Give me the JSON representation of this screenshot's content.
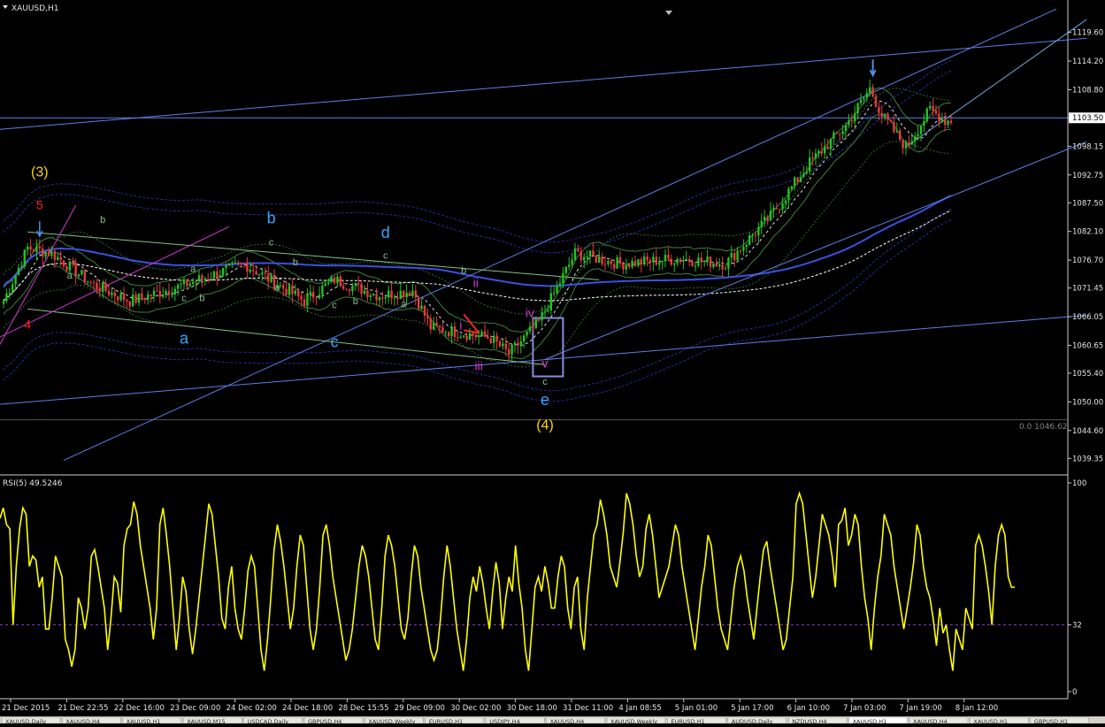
{
  "window": {
    "symbol_title": "XAUUSD,H1"
  },
  "rsi": {
    "title": "RSI(5) 49.5246",
    "ticks": [
      100,
      32,
      0
    ]
  },
  "price_axis": {
    "ticks": [
      "1119.60",
      "1114.20",
      "1108.80",
      "1103.50",
      "1098.15",
      "1092.75",
      "1087.50",
      "1082.10",
      "1076.70",
      "1071.45",
      "1066.05",
      "1060.65",
      "1055.40",
      "1050.00",
      "1044.60",
      "1039.35"
    ],
    "current_price": "1103.50",
    "fib_label": "0.0 1046.62"
  },
  "colors": {
    "background": "#000000",
    "candle_up": "#22c322",
    "candle_down": "#e83a3a",
    "rsi_line": "#ffff00",
    "channel_line": "#5f7fe8",
    "channel_green": "#86c08a",
    "ma_dotted": "#ffffff",
    "ma_blue": "#3a52e0",
    "orange_label": "#ffd400",
    "blue_label": "#35a8ff",
    "magenta_label": "#d23ad2",
    "red_label": "#ff2020"
  },
  "chart_data": [
    {
      "type": "candlestick",
      "title": "XAUUSD,H1",
      "ylim": [
        1036.4,
        1124.2
      ],
      "y_ticks": [
        1119.6,
        1114.2,
        1108.8,
        1103.5,
        1098.15,
        1092.75,
        1087.5,
        1082.1,
        1076.7,
        1071.45,
        1066.05,
        1060.65,
        1055.4,
        1050.0,
        1044.6,
        1039.35
      ],
      "x_tick_labels": [
        "21 Dec 2015",
        "21 Dec 22:55",
        "22 Dec 16:00",
        "23 Dec 09:00",
        "24 Dec 02:00",
        "24 Dec 18:00",
        "28 Dec 15:55",
        "29 Dec 09:00",
        "30 Dec 02:00",
        "30 Dec 18:00",
        "31 Dec 11:00",
        "4 Jan 08:55",
        "5 Jan 01:00",
        "5 Jan 17:00",
        "6 Jan 10:00",
        "7 Jan 03:00",
        "7 Jan 19:00",
        "8 Jan 12:00"
      ],
      "horizontal_lines": [
        1103.5,
        1046.62
      ],
      "price_path": [
        {
          "bar": 0,
          "price": 1069
        },
        {
          "bar": 8,
          "price": 1079
        },
        {
          "bar": 16,
          "price": 1078
        },
        {
          "bar": 30,
          "price": 1072
        },
        {
          "bar": 42,
          "price": 1069
        },
        {
          "bar": 60,
          "price": 1072
        },
        {
          "bar": 80,
          "price": 1076
        },
        {
          "bar": 100,
          "price": 1069
        },
        {
          "bar": 110,
          "price": 1073
        },
        {
          "bar": 125,
          "price": 1070
        },
        {
          "bar": 136,
          "price": 1071
        },
        {
          "bar": 142,
          "price": 1064
        },
        {
          "bar": 162,
          "price": 1062
        },
        {
          "bar": 168,
          "price": 1059
        },
        {
          "bar": 178,
          "price": 1065
        },
        {
          "bar": 190,
          "price": 1078
        },
        {
          "bar": 205,
          "price": 1076
        },
        {
          "bar": 225,
          "price": 1077
        },
        {
          "bar": 240,
          "price": 1076
        },
        {
          "bar": 255,
          "price": 1085
        },
        {
          "bar": 268,
          "price": 1095
        },
        {
          "bar": 280,
          "price": 1102
        },
        {
          "bar": 288,
          "price": 1109
        },
        {
          "bar": 292,
          "price": 1104
        },
        {
          "bar": 300,
          "price": 1098
        },
        {
          "bar": 308,
          "price": 1105
        },
        {
          "bar": 313,
          "price": 1103
        }
      ],
      "wave_labels": [
        {
          "text": "(3)",
          "bar": 12,
          "price": 1092.5,
          "color": "#ffd400"
        },
        {
          "text": "5",
          "bar": 12,
          "price": 1086.3,
          "color": "#ff2020"
        },
        {
          "text": "4",
          "bar": 8,
          "price": 1063.8,
          "color": "#ff2020"
        },
        {
          "text": "b",
          "bar": 33,
          "price": 1083.7,
          "color": "#86c08a"
        },
        {
          "text": "a",
          "bar": 22,
          "price": 1073.2,
          "color": "#86c08a"
        },
        {
          "text": "a",
          "bar": 63,
          "price": 1074.5,
          "color": "#86c08a"
        },
        {
          "text": "c",
          "bar": 60,
          "price": 1069.0,
          "color": "#86c08a"
        },
        {
          "text": "b",
          "bar": 66,
          "price": 1069.0,
          "color": "#86c08a"
        },
        {
          "text": "a",
          "bar": 60,
          "price": 1061.0,
          "color": "#35a8ff"
        },
        {
          "text": "b",
          "bar": 89,
          "price": 1083.6,
          "color": "#35a8ff"
        },
        {
          "text": "c",
          "bar": 89,
          "price": 1079.5,
          "color": "#86c08a"
        },
        {
          "text": "b",
          "bar": 97,
          "price": 1075.7,
          "color": "#86c08a"
        },
        {
          "text": "a",
          "bar": 91,
          "price": 1071.0,
          "color": "#86c08a"
        },
        {
          "text": "c",
          "bar": 110,
          "price": 1060.3,
          "color": "#35a8ff"
        },
        {
          "text": "c",
          "bar": 110,
          "price": 1067.6,
          "color": "#86c08a"
        },
        {
          "text": "b",
          "bar": 117,
          "price": 1068.4,
          "color": "#86c08a"
        },
        {
          "text": "d",
          "bar": 127,
          "price": 1080.9,
          "color": "#35a8ff"
        },
        {
          "text": "c",
          "bar": 127,
          "price": 1077.0,
          "color": "#86c08a"
        },
        {
          "text": "a",
          "bar": 133,
          "price": 1067.8,
          "color": "#86c08a"
        },
        {
          "text": "b",
          "bar": 153,
          "price": 1074.1,
          "color": "#86c08a"
        },
        {
          "text": "ii",
          "bar": 157,
          "price": 1071.6,
          "color": "#d23ad2"
        },
        {
          "text": "i",
          "bar": 152,
          "price": 1063.6,
          "color": "#d23ad2"
        },
        {
          "text": "iii",
          "bar": 158,
          "price": 1056.0,
          "color": "#d23ad2"
        },
        {
          "text": "iv",
          "bar": 175,
          "price": 1066.0,
          "color": "#d23ad2"
        },
        {
          "text": "v",
          "bar": 180,
          "price": 1056.5,
          "color": "#d23ad2"
        },
        {
          "text": "c",
          "bar": 180,
          "price": 1053.2,
          "color": "#86c08a"
        },
        {
          "text": "e",
          "bar": 180,
          "price": 1049.4,
          "color": "#35a8ff"
        },
        {
          "text": "(4)",
          "bar": 180,
          "price": 1044.8,
          "color": "#ffd400"
        }
      ]
    },
    {
      "type": "line",
      "title": "RSI(5) 49.5246",
      "ylim": [
        0,
        100
      ],
      "levels": [
        32
      ],
      "series": [
        {
          "values": [
            83,
            88,
            80,
            78,
            32,
            60,
            78,
            88,
            85,
            60,
            65,
            63,
            50,
            55,
            30,
            30,
            45,
            65,
            60,
            55,
            25,
            20,
            12,
            20,
            45,
            40,
            30,
            40,
            65,
            68,
            60,
            50,
            40,
            20,
            35,
            55,
            52,
            38,
            70,
            78,
            80,
            91,
            85,
            70,
            60,
            50,
            40,
            25,
            40,
            80,
            88,
            75,
            60,
            40,
            20,
            35,
            55,
            48,
            30,
            18,
            30,
            45,
            60,
            75,
            90,
            85,
            70,
            55,
            35,
            30,
            50,
            60,
            40,
            30,
            25,
            40,
            58,
            65,
            60,
            40,
            20,
            10,
            25,
            45,
            68,
            80,
            72,
            60,
            45,
            30,
            40,
            60,
            75,
            70,
            50,
            30,
            20,
            30,
            50,
            75,
            80,
            70,
            55,
            45,
            35,
            25,
            15,
            20,
            30,
            45,
            60,
            70,
            65,
            55,
            40,
            25,
            20,
            40,
            65,
            75,
            70,
            60,
            45,
            30,
            25,
            35,
            55,
            70,
            65,
            50,
            40,
            30,
            20,
            15,
            20,
            35,
            55,
            70,
            60,
            45,
            30,
            20,
            10,
            25,
            45,
            55,
            48,
            60,
            52,
            40,
            30,
            48,
            62,
            52,
            30,
            45,
            55,
            48,
            70,
            52,
            40,
            20,
            10,
            30,
            50,
            55,
            48,
            60,
            52,
            40,
            40,
            55,
            65,
            60,
            40,
            30,
            50,
            55,
            30,
            20,
            45,
            60,
            75,
            80,
            92,
            85,
            75,
            60,
            55,
            50,
            62,
            76,
            95,
            90,
            80,
            65,
            55,
            60,
            78,
            85,
            75,
            60,
            45,
            50,
            55,
            60,
            70,
            80,
            75,
            60,
            50,
            40,
            30,
            20,
            35,
            50,
            60,
            75,
            70,
            55,
            40,
            30,
            25,
            20,
            35,
            50,
            60,
            65,
            58,
            45,
            35,
            25,
            40,
            55,
            68,
            72,
            60,
            50,
            40,
            30,
            20,
            25,
            40,
            55,
            90,
            95,
            90,
            75,
            60,
            45,
            55,
            70,
            85,
            80,
            75,
            65,
            50,
            80,
            82,
            88,
            70,
            75,
            85,
            80,
            60,
            45,
            35,
            20,
            40,
            55,
            65,
            85,
            80,
            75,
            60,
            50,
            40,
            30,
            40,
            50,
            62,
            80,
            75,
            60,
            50,
            45,
            35,
            22,
            40,
            28,
            32,
            20,
            10,
            30,
            25,
            20,
            40,
            35,
            30,
            70,
            75,
            70,
            60,
            48,
            32,
            60,
            75,
            80,
            75,
            55,
            50,
            50
          ]
        }
      ]
    }
  ],
  "tabs": [
    "XAUUSD,Daily",
    "XAUUSD,H4",
    "XAUUSD,H1",
    "XAUUSD,M15",
    "USDCAD,Daily",
    "GBPUSD,H4",
    "XAUUSD,Weekly",
    "EURUSD,H1",
    "USDJPY,H4",
    "XAUUSD,H4",
    "XAUUSD,Weekly",
    "EURUSD,H1",
    "AUDUSD,Daily",
    "NZDUSD,H4",
    "XAUUSD,H1",
    "XAUUSD,H4",
    "XAUUSD,H1",
    "GBPUSD,H1"
  ]
}
